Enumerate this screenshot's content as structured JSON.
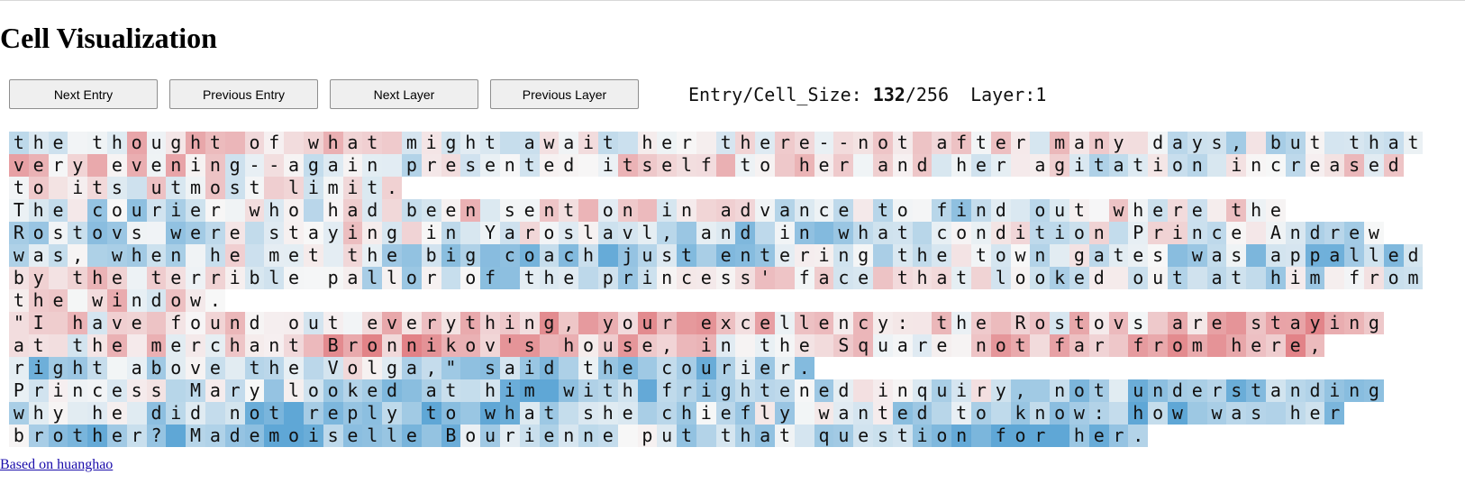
{
  "page": {
    "title": "Cell Visualization",
    "buttons": {
      "next_entry": "Next Entry",
      "previous_entry": "Previous Entry",
      "next_layer": "Next Layer",
      "previous_layer": "Previous Layer"
    },
    "info": {
      "entry_cell_size_label": "Entry/Cell_Size: ",
      "entry": "132",
      "cell_size": "/256",
      "layer_label": "Layer:",
      "layer": "1"
    },
    "credit_link": "Based on huanghao"
  },
  "colors": {
    "negative": "#5fa7d6",
    "neutral": "#f7f7f7",
    "positive": "#e07a7f"
  },
  "visualization": {
    "description_note": "",
    "lines": [
      "the thought of what might await her there--not after many days, but that",
      "very evening--again presented itself to her and her agitation increased",
      "to its utmost limit.",
      "The courier who had been sent on in advance to find out where the",
      "Rostovs were staying in Yaroslavl, and in what condition Prince Andrew",
      "was, when he met the big coach just entering the town gates was appalled",
      "by the terrible pallor of the princess' face that looked out at him from",
      "the window.",
      "\"I have found out everything, your excellency: the Rostovs are staying",
      "at the merchant Bronnikov's house, in the Square not far from here,",
      "right above the Volga,\" said the courier.",
      "Princess Mary looked at him with frightened inquiry, not understanding",
      "why he did not reply to what she chiefly wanted to know: how was her",
      "brother? Mademoiselle Bourienne put that question for her."
    ],
    "line_bias": [
      0.05,
      0.12,
      0.18,
      -0.05,
      -0.2,
      -0.35,
      -0.1,
      0.15,
      0.35,
      0.4,
      -0.35,
      -0.45,
      -0.5,
      -0.55
    ]
  }
}
